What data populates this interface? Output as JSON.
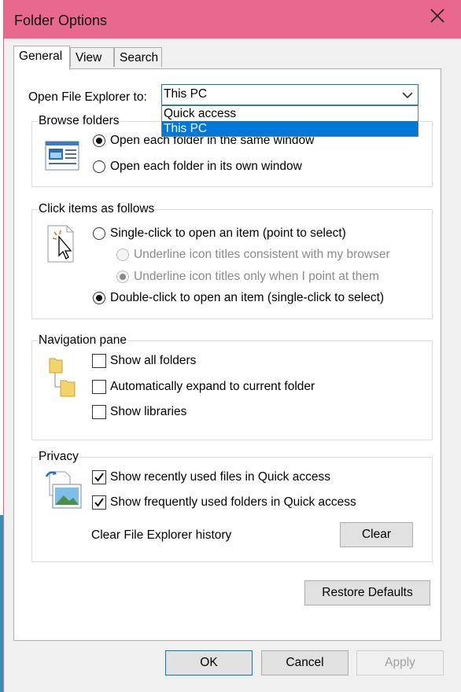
{
  "window": {
    "title": "Folder Options"
  },
  "tabs": [
    {
      "label": "General",
      "active": true
    },
    {
      "label": "View",
      "active": false
    },
    {
      "label": "Search",
      "active": false
    }
  ],
  "open_explorer": {
    "label": "Open File Explorer to:",
    "value": "This PC",
    "options": [
      "Quick access",
      "This PC"
    ],
    "selected_option": "This PC"
  },
  "browse_folders": {
    "title": "Browse folders",
    "options": [
      {
        "label": "Open each folder in the same window",
        "checked": true
      },
      {
        "label": "Open each folder in its own window",
        "checked": false
      }
    ]
  },
  "click_items": {
    "title": "Click items as follows",
    "single_click": "Single-click to open an item (point to select)",
    "underline_browser": "Underline icon titles consistent with my browser",
    "underline_point": "Underline icon titles only when I point at them",
    "double_click": "Double-click to open an item (single-click to select)"
  },
  "navigation_pane": {
    "title": "Navigation pane",
    "show_all_folders": "Show all folders",
    "auto_expand": "Automatically expand to current folder",
    "show_libraries": "Show libraries"
  },
  "privacy": {
    "title": "Privacy",
    "recent_files": "Show recently used files in Quick access",
    "frequent_folders": "Show frequently used folders in Quick access",
    "clear_history_label": "Clear File Explorer history",
    "clear_button": "Clear"
  },
  "restore_defaults": "Restore Defaults",
  "footer": {
    "ok": "OK",
    "cancel": "Cancel",
    "apply": "Apply"
  },
  "colors": {
    "titlebar": "#e8688f",
    "accent": "#0078d7"
  }
}
